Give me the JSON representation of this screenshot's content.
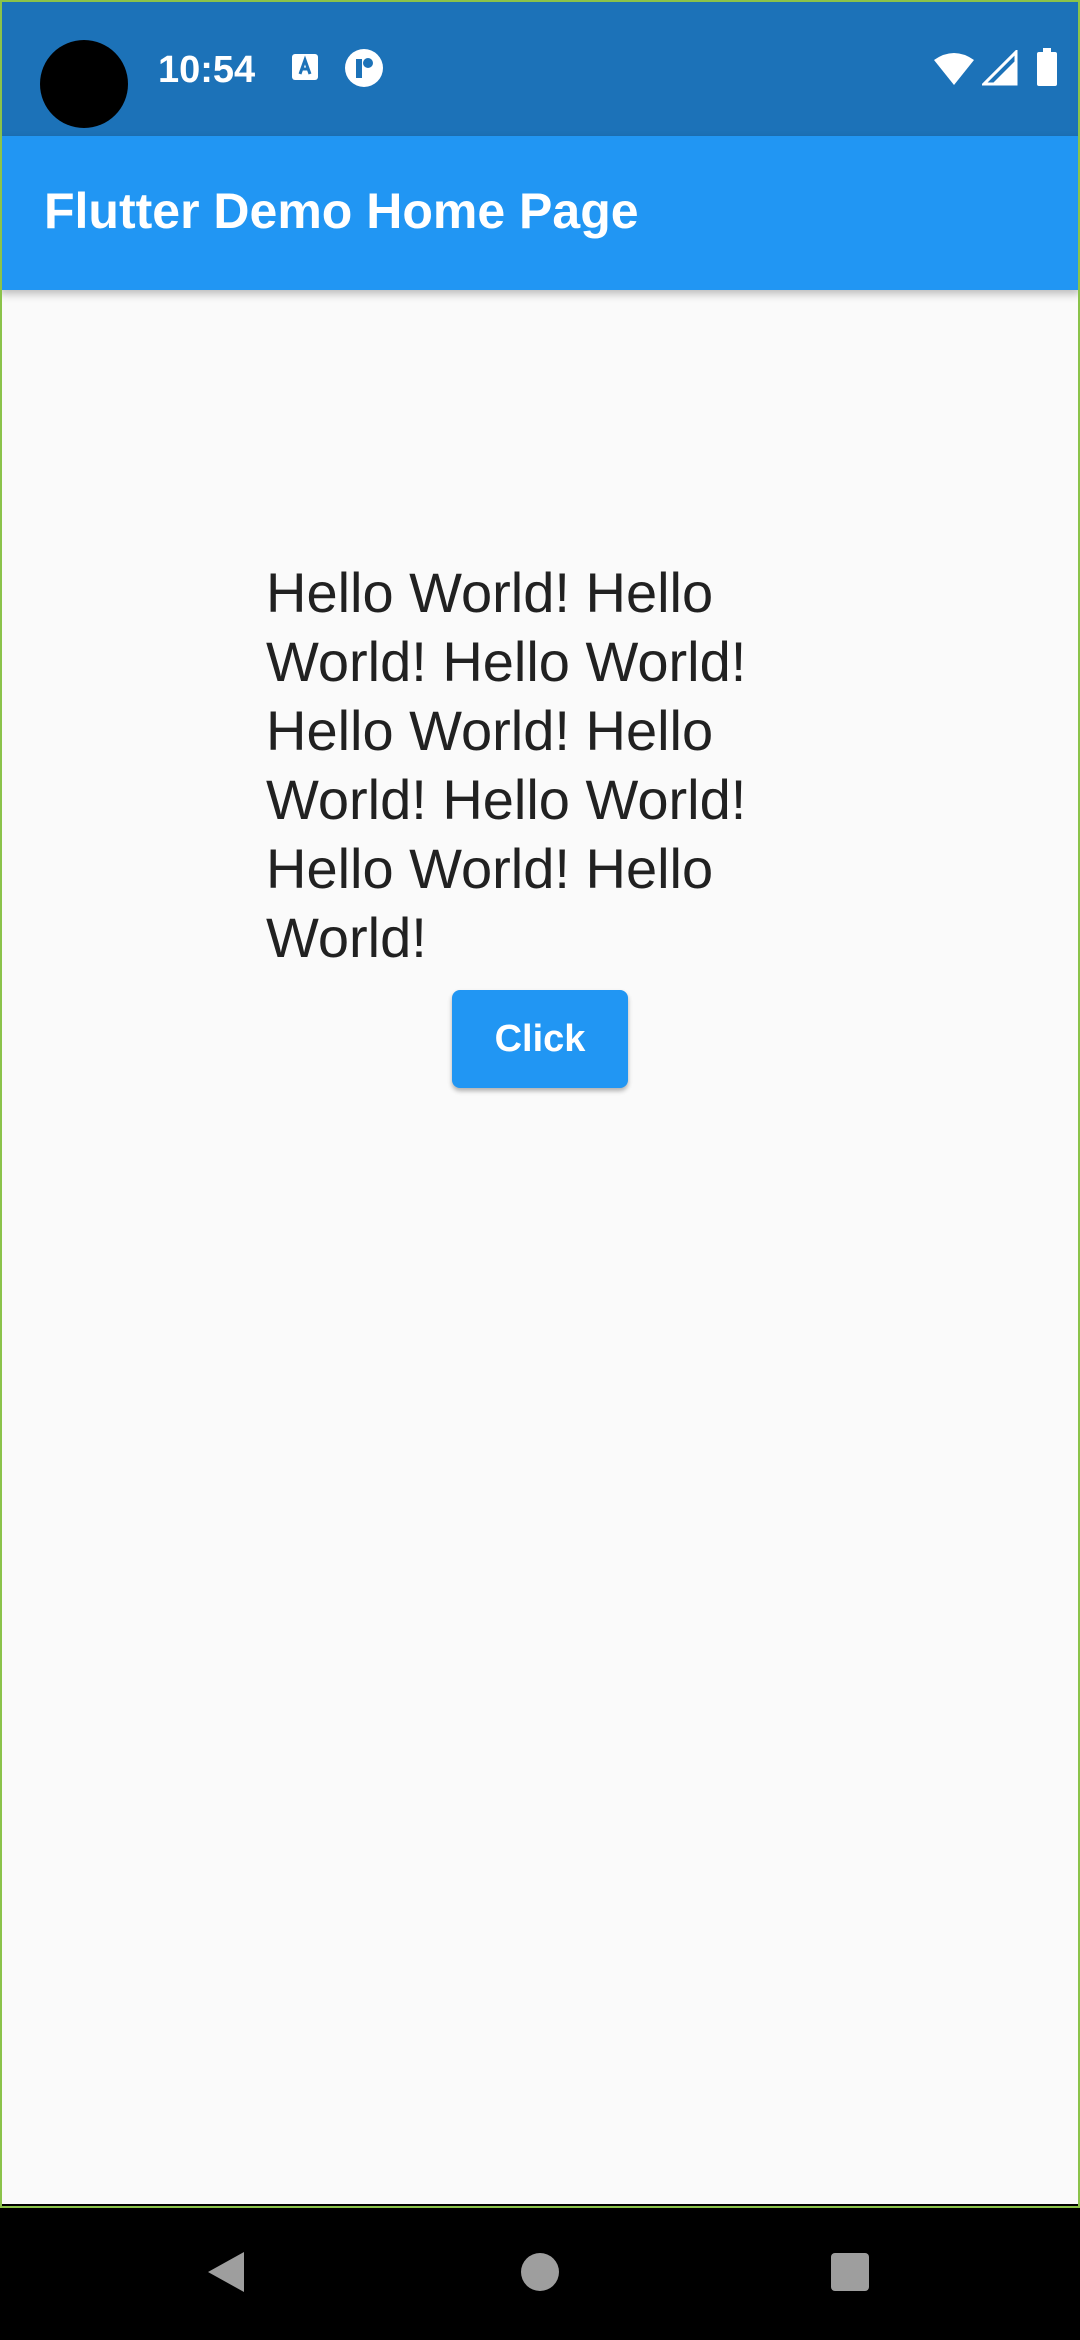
{
  "status_bar": {
    "time": "10:54",
    "icons": [
      "a-notification-icon",
      "r-notification-icon",
      "wifi-icon",
      "cell-signal-icon",
      "battery-icon"
    ],
    "background_color": "#1c72b8"
  },
  "app_bar": {
    "title": "Flutter Demo Home Page",
    "background_color": "#2196f3"
  },
  "main": {
    "text": "Hello World! Hello World! Hello World! Hello World! Hello World! Hello World! Hello World! Hello World!",
    "button_label": "Click",
    "button_color": "#2196f3"
  },
  "nav_bar": {
    "buttons": [
      "back-icon",
      "home-icon",
      "recents-icon"
    ]
  }
}
